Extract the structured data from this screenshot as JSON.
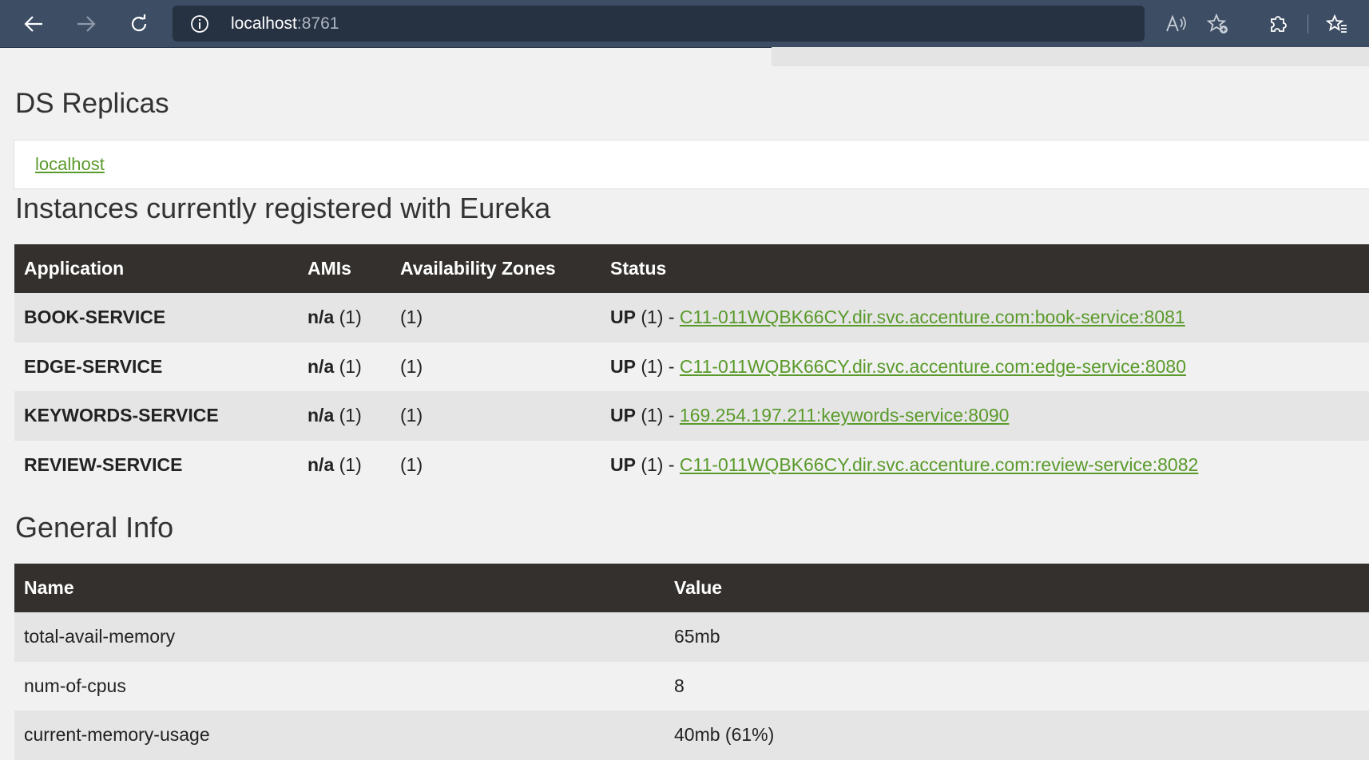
{
  "browser": {
    "host": "localhost",
    "port": ":8761"
  },
  "replicas": {
    "title": "DS Replicas",
    "link": "localhost"
  },
  "instances": {
    "title": "Instances currently registered with Eureka",
    "headers": [
      "Application",
      "AMIs",
      "Availability Zones",
      "Status"
    ],
    "rows": [
      {
        "app": "BOOK-SERVICE",
        "ami_bold": "n/a",
        "ami_count": " (1)",
        "zones": "(1)",
        "status_bold": "UP",
        "status_rest": " (1) - ",
        "link": "C11-011WQBK66CY.dir.svc.accenture.com:book-service:8081"
      },
      {
        "app": "EDGE-SERVICE",
        "ami_bold": "n/a",
        "ami_count": " (1)",
        "zones": "(1)",
        "status_bold": "UP",
        "status_rest": " (1) - ",
        "link": "C11-011WQBK66CY.dir.svc.accenture.com:edge-service:8080"
      },
      {
        "app": "KEYWORDS-SERVICE",
        "ami_bold": "n/a",
        "ami_count": " (1)",
        "zones": "(1)",
        "status_bold": "UP",
        "status_rest": " (1) - ",
        "link": "169.254.197.211:keywords-service:8090"
      },
      {
        "app": "REVIEW-SERVICE",
        "ami_bold": "n/a",
        "ami_count": " (1)",
        "zones": "(1)",
        "status_bold": "UP",
        "status_rest": " (1) - ",
        "link": "C11-011WQBK66CY.dir.svc.accenture.com:review-service:8082"
      }
    ]
  },
  "general": {
    "title": "General Info",
    "headers": [
      "Name",
      "Value"
    ],
    "rows": [
      {
        "name": "total-avail-memory",
        "value": "65mb"
      },
      {
        "name": "num-of-cpus",
        "value": "8"
      },
      {
        "name": "current-memory-usage",
        "value": "40mb (61%)"
      }
    ]
  },
  "colors": {
    "toolbar": "#3d4d64",
    "table_header": "#34302d",
    "link": "#5a9a2b"
  }
}
